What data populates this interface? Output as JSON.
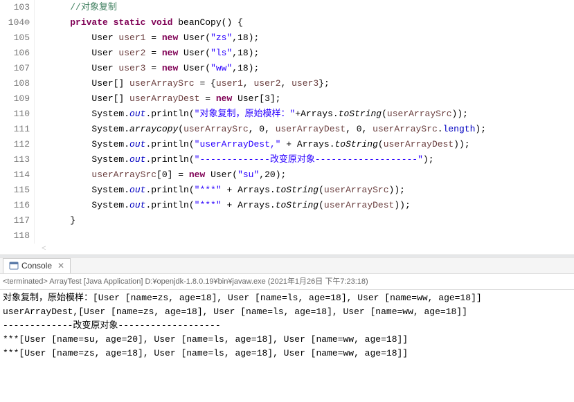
{
  "editor": {
    "lines": [
      {
        "num": "103",
        "fold": "",
        "html": "    <span class='cmt'>//对象复制</span>"
      },
      {
        "num": "104",
        "fold": "⊖",
        "html": "    <span class='kw'>private static void</span> beanCopy() {"
      },
      {
        "num": "105",
        "fold": "",
        "html": "        User <span class='brown'>user1</span> = <span class='kw'>new</span> User(<span class='str'>\"zs\"</span>,18);"
      },
      {
        "num": "106",
        "fold": "",
        "html": "        User <span class='brown'>user2</span> = <span class='kw'>new</span> User(<span class='str'>\"ls\"</span>,18);"
      },
      {
        "num": "107",
        "fold": "",
        "html": "        User <span class='brown'>user3</span> = <span class='kw'>new</span> User(<span class='str'>\"ww\"</span>,18);"
      },
      {
        "num": "108",
        "fold": "",
        "html": "        User[] <span class='brown'>userArraySrc</span> = {<span class='brown'>user1</span>, <span class='brown'>user2</span>, <span class='brown'>user3</span>};"
      },
      {
        "num": "109",
        "fold": "",
        "html": "        User[] <span class='brown'>userArrayDest</span> = <span class='kw'>new</span> User[3];"
      },
      {
        "num": "110",
        "fold": "",
        "html": "        System.<span class='sfld'>out</span>.println(<span class='str'>\"对象复制，原始模样：\"</span>+Arrays.<span class='smtd'>toString</span>(<span class='brown'>userArraySrc</span>));"
      },
      {
        "num": "111",
        "fold": "",
        "html": "        System.<span class='smtd'>arraycopy</span>(<span class='brown'>userArraySrc</span>, 0, <span class='brown'>userArrayDest</span>, 0, <span class='brown'>userArraySrc</span>.<span class='fld'>length</span>);"
      },
      {
        "num": "112",
        "fold": "",
        "html": "        System.<span class='sfld'>out</span>.println(<span class='str'>\"userArrayDest,\"</span> + Arrays.<span class='smtd'>toString</span>(<span class='brown'>userArrayDest</span>));"
      },
      {
        "num": "113",
        "fold": "",
        "html": "        System.<span class='sfld'>out</span>.println(<span class='str'>\"-------------改变原对象-------------------\"</span>);"
      },
      {
        "num": "114",
        "fold": "",
        "html": "        <span class='brown'>userArraySrc</span>[0] = <span class='kw'>new</span> User(<span class='str'>\"su\"</span>,20);"
      },
      {
        "num": "115",
        "fold": "",
        "html": "        System.<span class='sfld'>out</span>.println(<span class='str'>\"***\"</span> + Arrays.<span class='smtd'>toString</span>(<span class='brown'>userArraySrc</span>));"
      },
      {
        "num": "116",
        "fold": "",
        "html": "        System.<span class='sfld'>out</span>.println(<span class='str'>\"***\"</span> + Arrays.<span class='smtd'>toString</span>(<span class='brown'>userArrayDest</span>));"
      },
      {
        "num": "117",
        "fold": "",
        "html": "    }"
      },
      {
        "num": "118",
        "fold": "",
        "html": ""
      }
    ]
  },
  "console": {
    "tab_label": "Console",
    "terminated": "<terminated> ArrayTest [Java Application] D:¥openjdk-1.8.0.19¥bin¥javaw.exe (2021年1月26日 下午7:23:18)",
    "output_lines": [
      "对象复制，原始模样：[User [name=zs, age=18], User [name=ls, age=18], User [name=ww, age=18]]",
      "userArrayDest,[User [name=zs, age=18], User [name=ls, age=18], User [name=ww, age=18]]",
      "-------------改变原对象-------------------",
      "***[User [name=su, age=20], User [name=ls, age=18], User [name=ww, age=18]]",
      "***[User [name=zs, age=18], User [name=ls, age=18], User [name=ww, age=18]]"
    ]
  }
}
